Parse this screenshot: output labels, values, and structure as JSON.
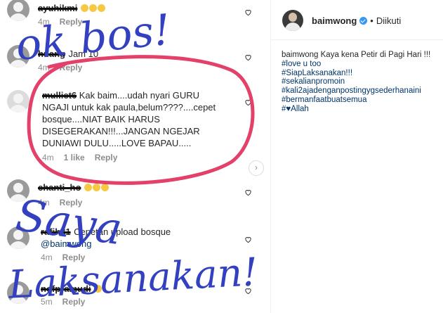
{
  "comments": [
    {
      "id": "c1",
      "username": "ayuhikmi",
      "text": "",
      "emojis": 3,
      "time": "4m",
      "likes": "",
      "reply": "Reply"
    },
    {
      "id": "c2",
      "username": "huang",
      "text": "Jam 10",
      "emojis": 0,
      "time": "4m",
      "likes": "",
      "reply": "Reply"
    },
    {
      "id": "c3",
      "username": "mulliet6",
      "text_lines": [
        "Kak baim....udah nyari GURU",
        "NGAJI untuk kak paula,belum????....cepet",
        "bosque....NIAT BAIK HARUS",
        "DISEGERAKAN!!!...JANGAN NGEJAR",
        "DUNIAWI DULU.....LOVE BAPAU....."
      ],
      "time": "4m",
      "likes": "1 like",
      "reply": "Reply"
    },
    {
      "id": "c4",
      "username": "chanti_ho",
      "text": "",
      "emojis": 3,
      "time": "4m",
      "likes": "",
      "reply": "Reply"
    },
    {
      "id": "c5",
      "username": "rafih81",
      "text": "Cepetan upload bosque",
      "mention": "@baimwong",
      "time": "4m",
      "likes": "",
      "reply": "Reply"
    },
    {
      "id": "c6",
      "username": "nofpramudi",
      "text": "",
      "emojis": 1,
      "time": "5m",
      "likes": "",
      "reply": "Reply"
    }
  ],
  "nav": {
    "next_label": "›"
  },
  "post": {
    "username": "baimwong",
    "follow_status": "Diikuti",
    "separator": "•",
    "caption_user": "baimwong",
    "caption_text": "Kaya kena Petir di Pagi Hari !!!",
    "hashtags": [
      "#love u too",
      "#SiapLaksanakan!!!",
      "#sekalianpromoin",
      "#kali2ajadenganpostingygsederhanaini",
      "#bermanfaatbuatsemua",
      "#♥Allah"
    ]
  },
  "annotations": {
    "top": "ok bos!",
    "middle": "Saya",
    "bottom": "Laksanakan!"
  },
  "colors": {
    "annotation_ink": "#3340c0",
    "circle": "#e3406a",
    "link": "#003569",
    "muted": "#8e8e8e",
    "verified": "#3897f0"
  }
}
